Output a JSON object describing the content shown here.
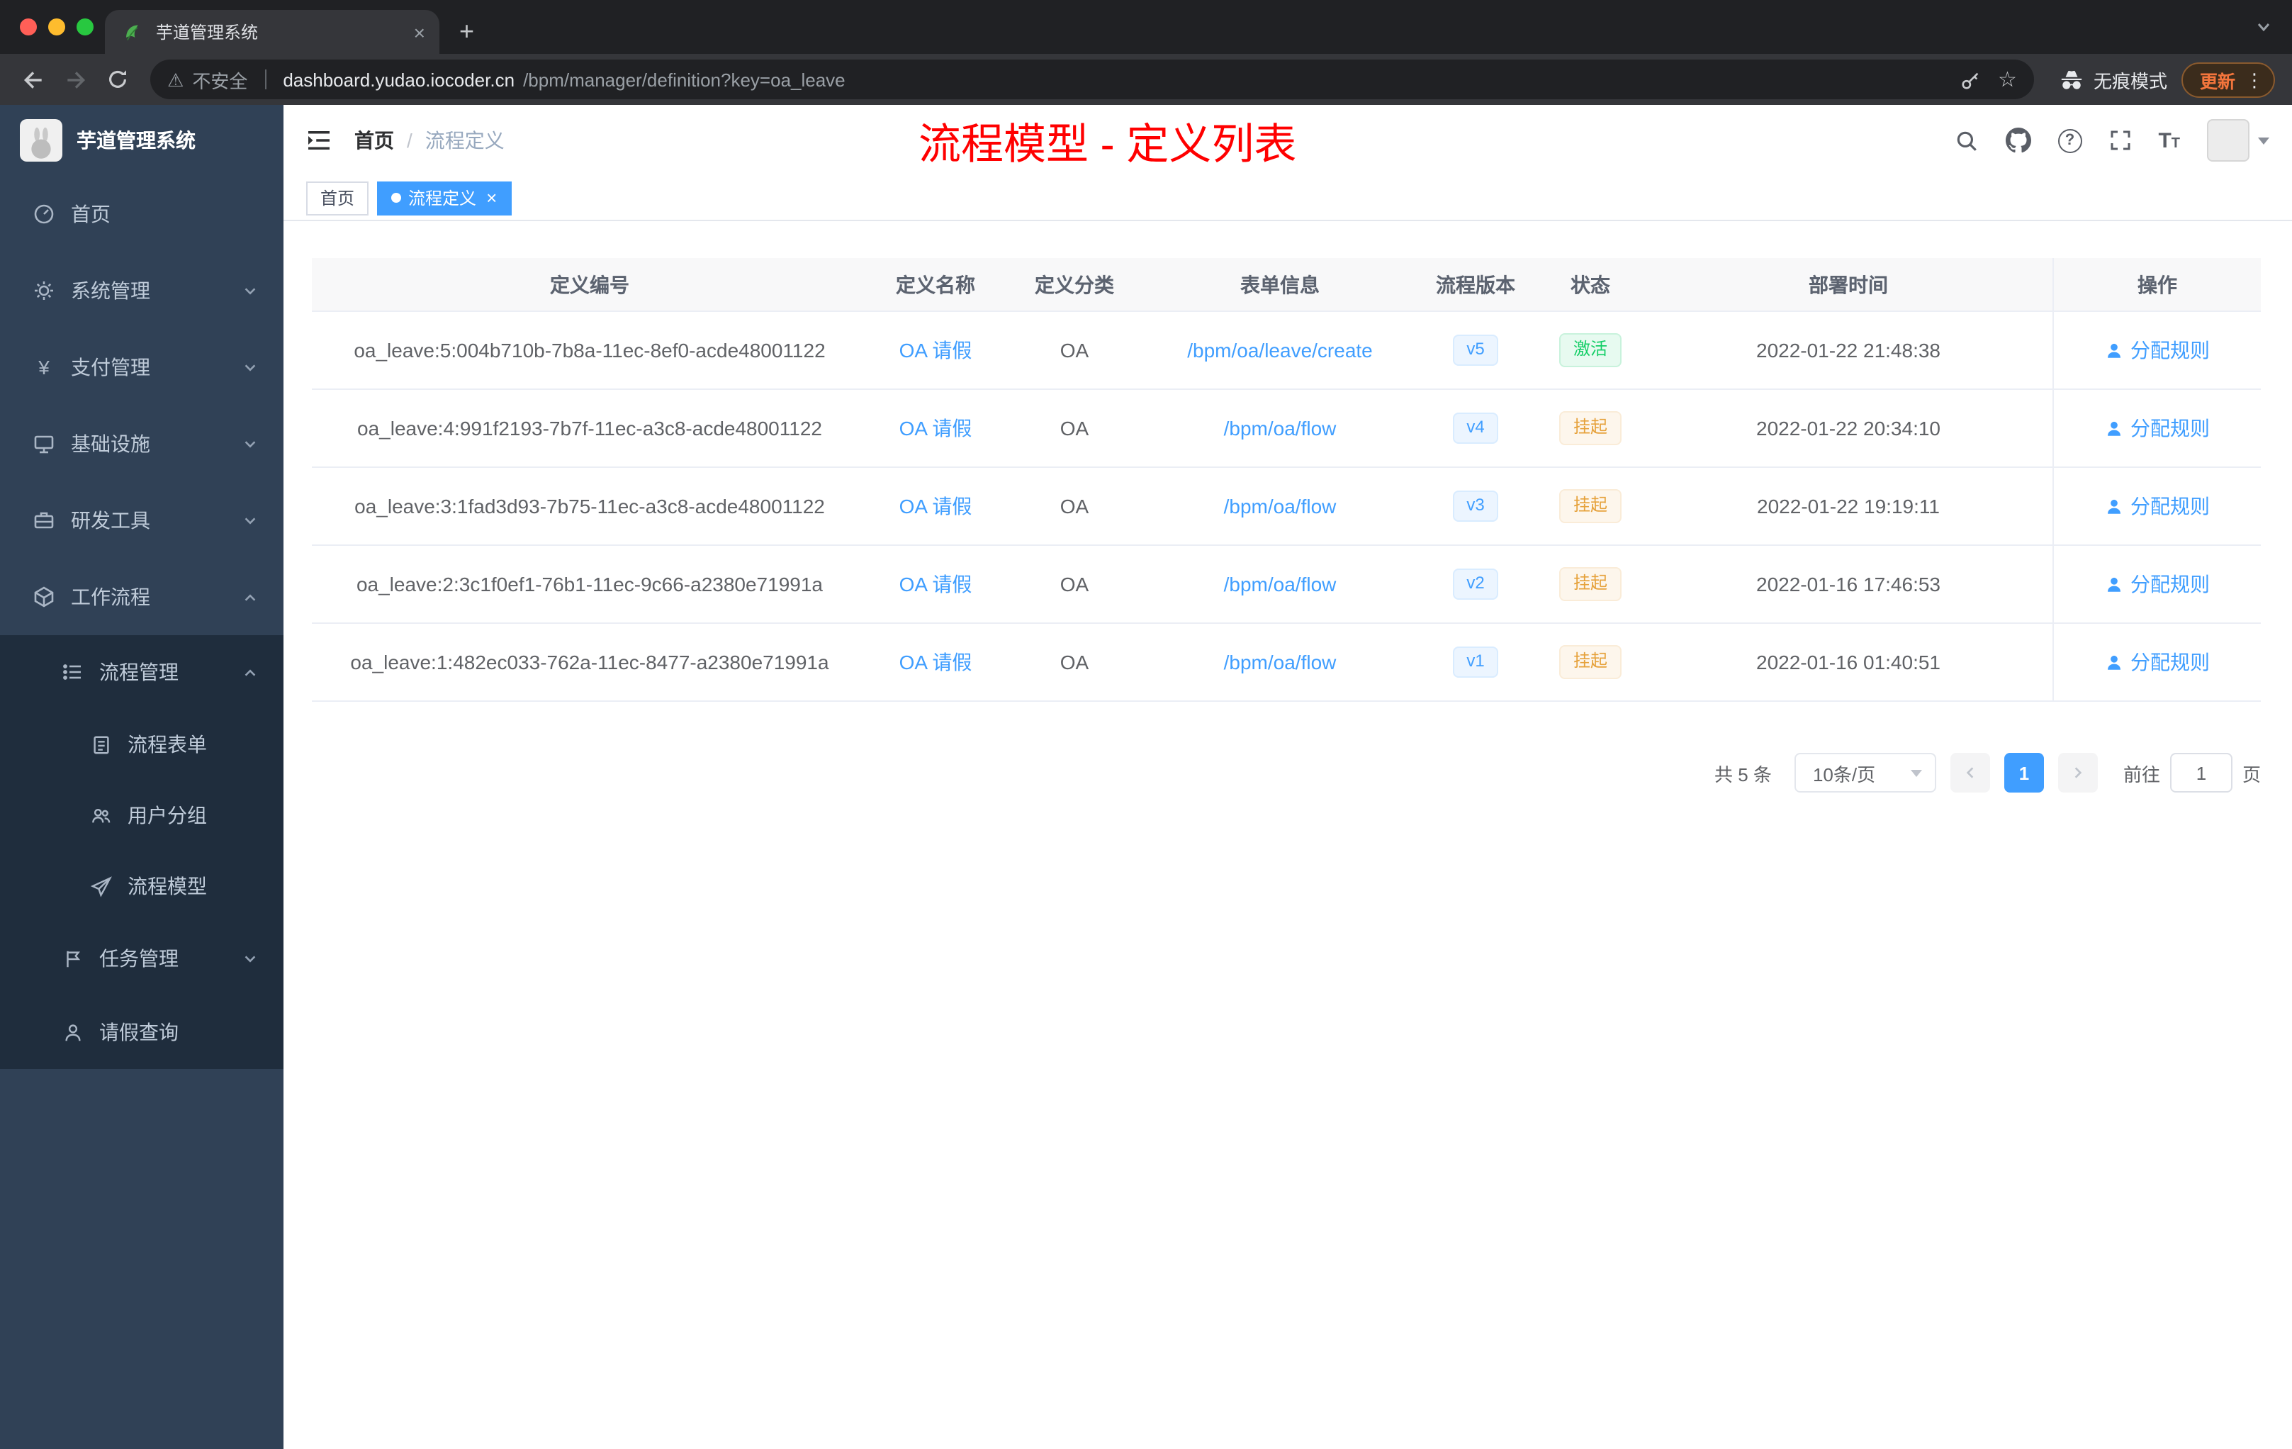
{
  "colors": {
    "accent": "#409eff",
    "success": "#13ce66",
    "warning": "#e6a23c",
    "annotation_red": "#ff0000",
    "sidebar_bg": "#304156",
    "submenu_bg": "#1f2d3d"
  },
  "glyphs": {
    "close": "×",
    "plus": "+",
    "dots": "⋮",
    "star": "☆",
    "warning": "⚠",
    "question": "?",
    "yen": "¥",
    "font_large": "T",
    "font_small": "T"
  },
  "browser": {
    "tab_title": "芋道管理系统",
    "security_label": "不安全",
    "url_host": "dashboard.yudao.iocoder.cn",
    "url_path": "/bpm/manager/definition?key=oa_leave",
    "incognito_label": "无痕模式",
    "update_label": "更新"
  },
  "sidebar": {
    "app_title": "芋道管理系统",
    "items": [
      {
        "label": "首页",
        "icon": "dashboard-icon"
      },
      {
        "label": "系统管理",
        "icon": "gear-icon"
      },
      {
        "label": "支付管理",
        "icon": "yen-icon"
      },
      {
        "label": "基础设施",
        "icon": "monitor-icon"
      },
      {
        "label": "研发工具",
        "icon": "toolbox-icon"
      },
      {
        "label": "工作流程",
        "icon": "cube-icon"
      },
      {
        "label": "流程管理",
        "icon": "list-icon"
      },
      {
        "label": "流程表单",
        "icon": "document-icon"
      },
      {
        "label": "用户分组",
        "icon": "user-group-icon"
      },
      {
        "label": "流程模型",
        "icon": "paper-plane-icon"
      },
      {
        "label": "任务管理",
        "icon": "flag-icon"
      },
      {
        "label": "请假查询",
        "icon": "person-icon"
      }
    ]
  },
  "header": {
    "breadcrumb": {
      "home": "首页",
      "separator": "/",
      "current": "流程定义"
    },
    "annotation": "流程模型 - 定义列表"
  },
  "tags": {
    "home": "首页",
    "active": "流程定义"
  },
  "table": {
    "columns": [
      "定义编号",
      "定义名称",
      "定义分类",
      "表单信息",
      "流程版本",
      "状态",
      "部署时间",
      "操作"
    ],
    "rows": [
      {
        "id": "oa_leave:5:004b710b-7b8a-11ec-8ef0-acde48001122",
        "name": "OA 请假",
        "category": "OA",
        "form": "/bpm/oa/leave/create",
        "version": "v5",
        "status": "激活",
        "status_type": "success",
        "time": "2022-01-22 21:48:38",
        "action": "分配规则"
      },
      {
        "id": "oa_leave:4:991f2193-7b7f-11ec-a3c8-acde48001122",
        "name": "OA 请假",
        "category": "OA",
        "form": "/bpm/oa/flow",
        "version": "v4",
        "status": "挂起",
        "status_type": "warning",
        "time": "2022-01-22 20:34:10",
        "action": "分配规则"
      },
      {
        "id": "oa_leave:3:1fad3d93-7b75-11ec-a3c8-acde48001122",
        "name": "OA 请假",
        "category": "OA",
        "form": "/bpm/oa/flow",
        "version": "v3",
        "status": "挂起",
        "status_type": "warning",
        "time": "2022-01-22 19:19:11",
        "action": "分配规则"
      },
      {
        "id": "oa_leave:2:3c1f0ef1-76b1-11ec-9c66-a2380e71991a",
        "name": "OA 请假",
        "category": "OA",
        "form": "/bpm/oa/flow",
        "version": "v2",
        "status": "挂起",
        "status_type": "warning",
        "time": "2022-01-16 17:46:53",
        "action": "分配规则"
      },
      {
        "id": "oa_leave:1:482ec033-762a-11ec-8477-a2380e71991a",
        "name": "OA 请假",
        "category": "OA",
        "form": "/bpm/oa/flow",
        "version": "v1",
        "status": "挂起",
        "status_type": "warning",
        "time": "2022-01-16 01:40:51",
        "action": "分配规则"
      }
    ]
  },
  "pagination": {
    "total": "共 5 条",
    "page_size": "10条/页",
    "current_page": "1",
    "goto_label": "前往",
    "goto_value": "1",
    "page_unit": "页"
  }
}
